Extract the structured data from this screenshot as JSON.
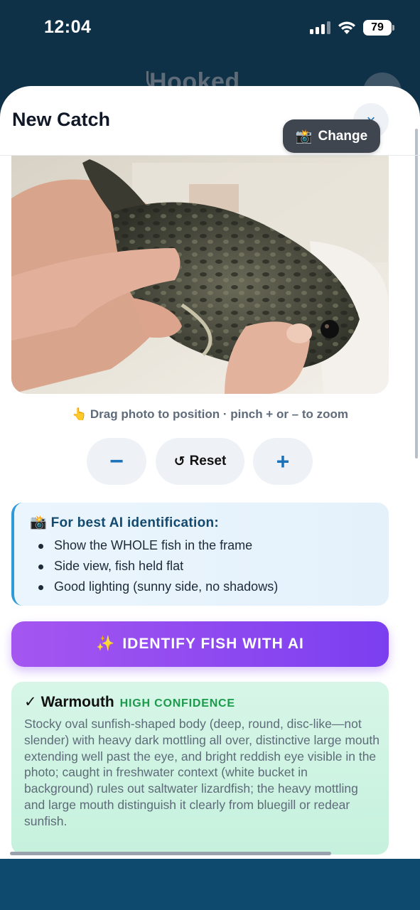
{
  "status_bar": {
    "time": "12:04",
    "battery": "79"
  },
  "background_app": {
    "logo_text": "Hooked"
  },
  "sheet": {
    "title": "New Catch",
    "close_label": "×",
    "change_label": "Change",
    "change_emoji": "📸"
  },
  "photo": {
    "description_icon": "fish-photo"
  },
  "hint": {
    "emoji": "👆",
    "text": "Drag photo to position · pinch + or – to zoom"
  },
  "zoom_controls": {
    "minus": "−",
    "reset": "Reset",
    "reset_icon": "↺",
    "plus": "+"
  },
  "tips": {
    "emoji": "📸",
    "title": "For best AI identification:",
    "items": [
      "Show the WHOLE fish in the frame",
      "Side view, fish held flat",
      "Good lighting (sunny side, no shadows)"
    ]
  },
  "identify_button": {
    "emoji": "✨",
    "label": "IDENTIFY FISH WITH AI"
  },
  "result": {
    "check": "✓",
    "species": "Warmouth",
    "confidence": "HIGH CONFIDENCE",
    "description": "Stocky oval sunfish-shaped body (deep, round, disc-like—not slender) with heavy dark mottling all over, distinctive large mouth extending well past the eye, and bright reddish eye visible in the photo; caught in freshwater context (white bucket in background) rules out saltwater lizardfish; the heavy mottling and large mouth distinguish it clearly from bluegill or redear sunfish."
  },
  "colors": {
    "accent": "#1d72b8",
    "ai_button_start": "#a556f0",
    "ai_button_end": "#7b3ff0",
    "confidence": "#1c9a4c"
  }
}
